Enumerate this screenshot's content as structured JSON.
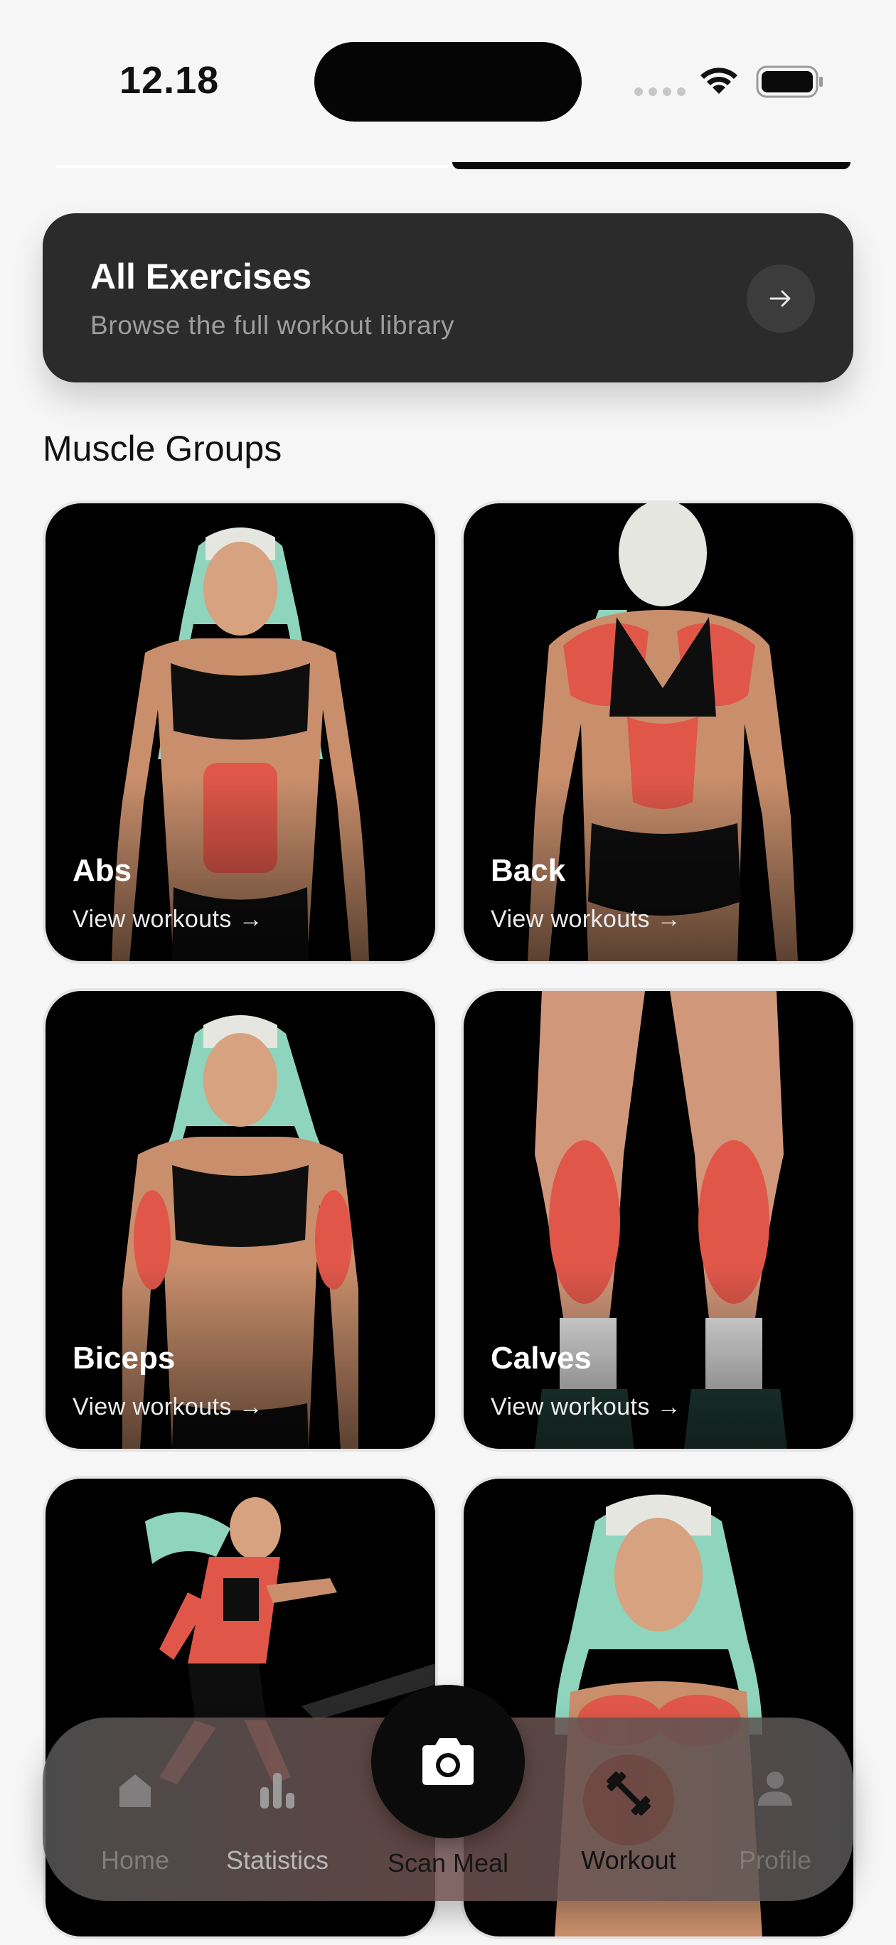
{
  "status_bar": {
    "time": "12.18"
  },
  "all_exercises": {
    "title": "All Exercises",
    "subtitle": "Browse the full workout library",
    "arrow_icon": "arrow-right-icon"
  },
  "muscle_groups": {
    "heading": "Muscle Groups",
    "cards": [
      {
        "title": "Abs",
        "cta": "View workouts →",
        "highlight": "abdominals"
      },
      {
        "title": "Back",
        "cta": "View workouts →",
        "highlight": "back"
      },
      {
        "title": "Biceps",
        "cta": "View workouts →",
        "highlight": "biceps"
      },
      {
        "title": "Calves",
        "cta": "View workouts →",
        "highlight": "calves"
      },
      {
        "title": "",
        "cta": "",
        "highlight": "cardio"
      },
      {
        "title": "",
        "cta": "",
        "highlight": "chest"
      }
    ]
  },
  "bottom_nav": {
    "items": [
      {
        "label": "Home",
        "icon": "home-icon",
        "active": false
      },
      {
        "label": "Statistics",
        "icon": "bar-chart-icon",
        "active": false
      },
      {
        "label": "Scan Meal",
        "icon": "camera-icon",
        "active": false
      },
      {
        "label": "Workout",
        "icon": "dumbbell-icon",
        "active": true
      },
      {
        "label": "Profile",
        "icon": "person-icon",
        "active": false
      }
    ]
  },
  "colors": {
    "background": "#f6f6f6",
    "card_dark": "#2b2b2b",
    "muscle_highlight": "#e0574a",
    "hair": "#8fd4bd"
  }
}
